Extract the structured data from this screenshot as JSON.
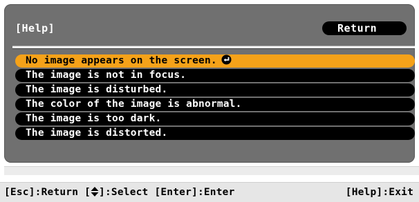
{
  "panel": {
    "title": "[Help]",
    "return_label": "Return"
  },
  "help_items": [
    {
      "label": "No image appears on the screen.",
      "selected": true,
      "icon": "enter-icon"
    },
    {
      "label": "The image is not in focus.",
      "selected": false
    },
    {
      "label": "The image is disturbed.",
      "selected": false
    },
    {
      "label": "The color of the image is abnormal.",
      "selected": false
    },
    {
      "label": "The image is too dark.",
      "selected": false
    },
    {
      "label": "The image is distorted.",
      "selected": false
    }
  ],
  "footer": {
    "esc": "[Esc]:Return",
    "select_open": "[",
    "select_close": "]:Select",
    "enter": "[Enter]:Enter",
    "help_exit": "[Help]:Exit",
    "select_icon": "up-down-arrow-icon"
  },
  "colors": {
    "panel_background": "#707070",
    "item_background": "#000000",
    "selected_background": "#f5a219",
    "footer_background": "#e6e6e6"
  }
}
